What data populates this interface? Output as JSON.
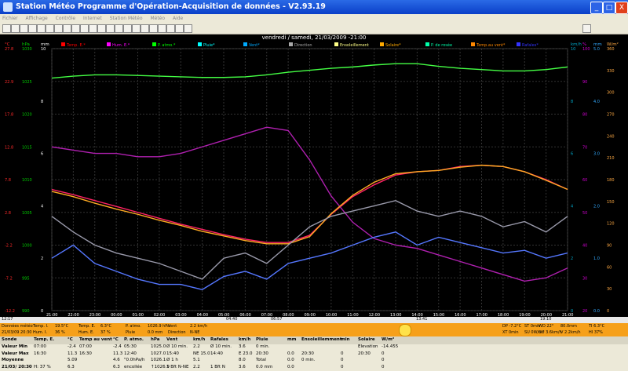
{
  "window": {
    "title": "Station Météo Programme d'Opération-Acquisition de données - V2.93.19",
    "buttons": {
      "minimize": "_",
      "maximize": "□",
      "close": "X"
    }
  },
  "menu": [
    "Fichier",
    "Affichage",
    "Contrôle",
    "Internet",
    "Station Météo",
    "Météo",
    "Aide"
  ],
  "chart": {
    "title": "vendredi / samedi, 21/03/2009 -21:00",
    "left_axes": [
      {
        "unit": "°C",
        "color": "#ff2a2a",
        "ticks": [
          "27.8",
          "22.9",
          "17.8",
          "12.8",
          "7.8",
          "2.8",
          "-2.2",
          "-7.2",
          "-12.2"
        ]
      },
      {
        "unit": "hPa",
        "color": "#00cc00",
        "ticks": [
          "1030",
          "1025",
          "1020",
          "1015",
          "1010",
          "1005",
          "1000",
          "995",
          "990"
        ]
      },
      {
        "unit": "mm",
        "color": "#ffffff",
        "ticks": [
          "10",
          "8",
          "6",
          "4",
          "2",
          "0"
        ]
      }
    ],
    "right_axes": [
      {
        "unit": "km/h",
        "color": "#00aacc",
        "ticks": [
          "10",
          "8",
          "6",
          "4",
          "2",
          "0"
        ]
      },
      {
        "unit": "%",
        "color": "#cc00cc",
        "ticks": [
          "100",
          "90",
          "80",
          "70",
          "60",
          "50",
          "40",
          "30",
          "20"
        ]
      },
      {
        "unit": "mm",
        "color": "#33aaff",
        "ticks": [
          "5.0",
          "4.0",
          "3.0",
          "2.0",
          "1.0",
          "0.0"
        ]
      },
      {
        "unit": "W/m²",
        "color": "#ffaa44",
        "ticks": [
          "360",
          "330",
          "300",
          "270",
          "240",
          "210",
          "180",
          "150",
          "120",
          "90",
          "60",
          "30",
          "0"
        ]
      }
    ],
    "legend": [
      {
        "label": "Temp. E.*",
        "color": "#ff0000"
      },
      {
        "label": "Hum. E.*",
        "color": "#ff00ff"
      },
      {
        "label": "P. atmo.*",
        "color": "#00ff00"
      },
      {
        "label": "Pluie*",
        "color": "#00ffff"
      },
      {
        "label": "Vent*",
        "color": "#00aaff"
      },
      {
        "label": "Direction",
        "color": "#aaaaaa"
      },
      {
        "label": "Ensoleillement",
        "color": "#ffff88"
      },
      {
        "label": "Solaire*",
        "color": "#ffaa00"
      },
      {
        "label": "P. de rosée",
        "color": "#00ffaa"
      },
      {
        "label": "Temp.au vent*",
        "color": "#ff8800"
      },
      {
        "label": "Rafales*",
        "color": "#3333ff"
      }
    ],
    "x_ticks": [
      "21:00",
      "22:00",
      "23:00",
      "00:00",
      "01:00",
      "02:00",
      "03:00",
      "04:00",
      "05:00",
      "06:00",
      "07:00",
      "08:00",
      "09:00",
      "10:00",
      "11:00",
      "12:00",
      "13:00",
      "14:00",
      "15:00",
      "16:00",
      "17:00",
      "18:00",
      "19:00",
      "20:00",
      "21:00"
    ],
    "xbar_labels": [
      "12:17",
      "04:40",
      "06:57",
      "13:41",
      "19:10"
    ]
  },
  "chart_data": {
    "type": "line",
    "title": "vendredi / samedi, 21/03/2009 -21:00",
    "x": [
      "21:00",
      "22:00",
      "23:00",
      "00:00",
      "01:00",
      "02:00",
      "03:00",
      "04:00",
      "05:00",
      "06:00",
      "07:00",
      "08:00",
      "09:00",
      "10:00",
      "11:00",
      "12:00",
      "13:00",
      "14:00",
      "15:00",
      "16:00",
      "17:00",
      "18:00",
      "19:00",
      "20:00",
      "21:00"
    ],
    "series": [
      {
        "name": "Temp. E.*",
        "unit": "°C",
        "values": [
          6.3,
          5.5,
          4.6,
          3.7,
          2.8,
          1.9,
          1.0,
          0.2,
          -0.6,
          -1.3,
          -1.8,
          -1.8,
          -0.7,
          2.5,
          5.2,
          7.0,
          8.5,
          9.0,
          9.2,
          9.8,
          10.0,
          9.8,
          9.0,
          7.8,
          6.3
        ]
      },
      {
        "name": "Hum. E.*",
        "unit": "%",
        "values": [
          70,
          69,
          68,
          68,
          67,
          67,
          68,
          70,
          72,
          74,
          76,
          75,
          66,
          55,
          47,
          42,
          40,
          39,
          37,
          35,
          33,
          31,
          29,
          30,
          33
        ]
      },
      {
        "name": "P. atmo.*",
        "unit": "hPa",
        "values": [
          1025.5,
          1025.8,
          1026.0,
          1026.0,
          1025.9,
          1025.8,
          1025.7,
          1025.6,
          1025.6,
          1025.7,
          1026.0,
          1026.4,
          1026.7,
          1027.0,
          1027.2,
          1027.5,
          1027.7,
          1027.7,
          1027.3,
          1027.0,
          1026.8,
          1026.6,
          1026.6,
          1026.8,
          1027.2
        ]
      },
      {
        "name": "Temp.au vent*",
        "unit": "°C",
        "values": [
          6.0,
          5.2,
          4.2,
          3.3,
          2.5,
          1.6,
          0.8,
          -0.1,
          -0.8,
          -1.5,
          -2.0,
          -2.0,
          -0.9,
          2.6,
          5.4,
          7.4,
          8.7,
          9.0,
          9.2,
          9.7,
          10.0,
          9.8,
          9.0,
          7.7,
          6.3
        ]
      },
      {
        "name": "Vent*",
        "unit": "km/h",
        "values": [
          2.0,
          2.5,
          1.8,
          1.5,
          1.2,
          1.0,
          1.0,
          0.8,
          1.3,
          1.5,
          1.2,
          1.8,
          2.0,
          2.2,
          2.5,
          2.8,
          3.0,
          2.5,
          2.8,
          2.6,
          2.4,
          2.2,
          2.3,
          2.0,
          2.2
        ]
      },
      {
        "name": "Rafales*",
        "unit": "km/h",
        "values": [
          3.6,
          3.0,
          2.5,
          2.2,
          2.0,
          1.8,
          1.5,
          1.2,
          2.0,
          2.2,
          1.8,
          2.5,
          3.2,
          3.6,
          3.8,
          4.0,
          4.2,
          3.8,
          3.6,
          3.8,
          3.6,
          3.2,
          3.4,
          3.0,
          3.6
        ]
      }
    ],
    "ylim": [
      -12.2,
      27.8
    ]
  },
  "strip": [
    {
      "l1": "Données météo",
      "l2": "21/03/09 20:30"
    },
    {
      "l1": "Temp. I.",
      "v1": "19.5°C",
      "l2": "Hum. I.",
      "v2": "36 %"
    },
    {
      "l1": "Temp. E.",
      "v1": "6.3°C",
      "l2": "Hum. E.",
      "v2": "37 %"
    },
    {
      "l1": "P. atmo.",
      "v1": "1026.9 hPa",
      "l2": "Pluie",
      "v2": "0.0 mm"
    },
    {
      "l1": "Vent",
      "v1": "2.2 km/h",
      "l2": "Direction",
      "v2": "N-NE"
    },
    {
      "l1": "DP -7.2°C",
      "v1": "ST 0min",
      "l2": "XT 0min",
      "v2": "SU 0W/m²"
    },
    {
      "l1": "WD 22°",
      "v1": "80.0mm",
      "l2": "GU 3.6km/h",
      "v2": "V 2.2km/h"
    },
    {
      "l1": "TI 6.3°C",
      "l2": "HI 37%"
    }
  ],
  "table": {
    "headers": [
      "Sonde",
      "Temp. E.",
      "°C",
      "Temp au vent",
      "°C",
      "P. atmo.",
      "hPa",
      "Vent",
      "km/h",
      "Rafales",
      "km/h",
      "Pluie",
      "mm",
      "Ensoleillemment",
      "min",
      "Solaire",
      "W/m²"
    ],
    "rows": [
      [
        "Valeur Min",
        "07:00",
        "-2.4",
        "07:00",
        "-2.4",
        "05:30",
        "1025.0",
        "Ø 10 min.",
        "2.2",
        "Ø 10 min.",
        "3.6",
        "0 min.",
        "",
        "",
        "",
        "Elevation",
        "-14.455"
      ],
      [
        "Valeur Max",
        "16:30",
        "11.3",
        "16:30",
        "11.3",
        "12:40",
        "1027.0",
        "15:40",
        "NE 15.0",
        "14:40",
        "E 23.0",
        "20:30",
        "0.0",
        "20:30",
        "0",
        "20:30",
        "0"
      ],
      [
        "Moyenne",
        "",
        "5.09",
        "",
        "4.6",
        "\"0.0hPa/h",
        "1026.1",
        "Ø 1 h",
        "5.1",
        "",
        "8.0",
        "Total",
        "0.0",
        "0 min.",
        "0",
        "",
        "0"
      ],
      [
        "21/03/ 20:30",
        "H: 37 %",
        "6.3",
        "",
        "6.3",
        "encollée",
        "↑1026.9",
        "1 Bft N-NE",
        "2.2",
        "1 Bft N",
        "3.6",
        "0.0 mm",
        "0.0",
        "",
        "0",
        "",
        "0"
      ]
    ]
  }
}
